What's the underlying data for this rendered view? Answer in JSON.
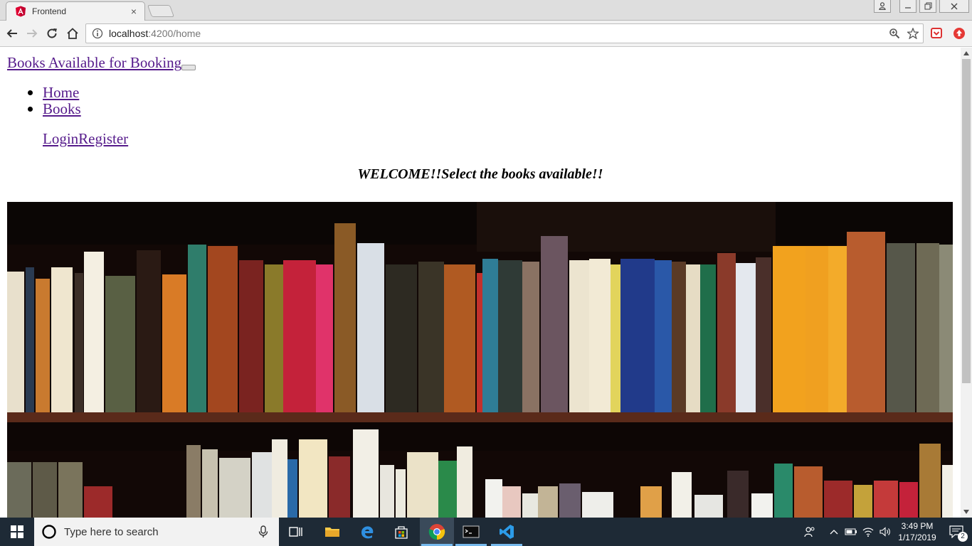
{
  "browser": {
    "tab_title": "Frontend",
    "tab_close": "×",
    "url_host": "localhost",
    "url_path": ":4200/home"
  },
  "page": {
    "brand": "Books Available for Booking",
    "nav_items": [
      {
        "label": "Home"
      },
      {
        "label": "Books"
      }
    ],
    "login_label": "Login",
    "register_label": "Register",
    "welcome": "WELCOME!!Select the books available!!"
  },
  "taskbar": {
    "search_placeholder": "Type here to search",
    "time": "3:49 PM",
    "date": "1/17/2019",
    "notification_count": "2"
  },
  "icons": {
    "favicon": "angular-icon",
    "back": "back-arrow-icon",
    "forward": "forward-arrow-icon",
    "reload": "reload-icon",
    "home": "home-icon",
    "info": "info-icon",
    "zoom": "zoom-icon",
    "bookmark": "star-icon"
  },
  "colors": {
    "link_visited": "#551a8b",
    "taskbar": "#1e2a36",
    "angular_red": "#dd0031"
  }
}
